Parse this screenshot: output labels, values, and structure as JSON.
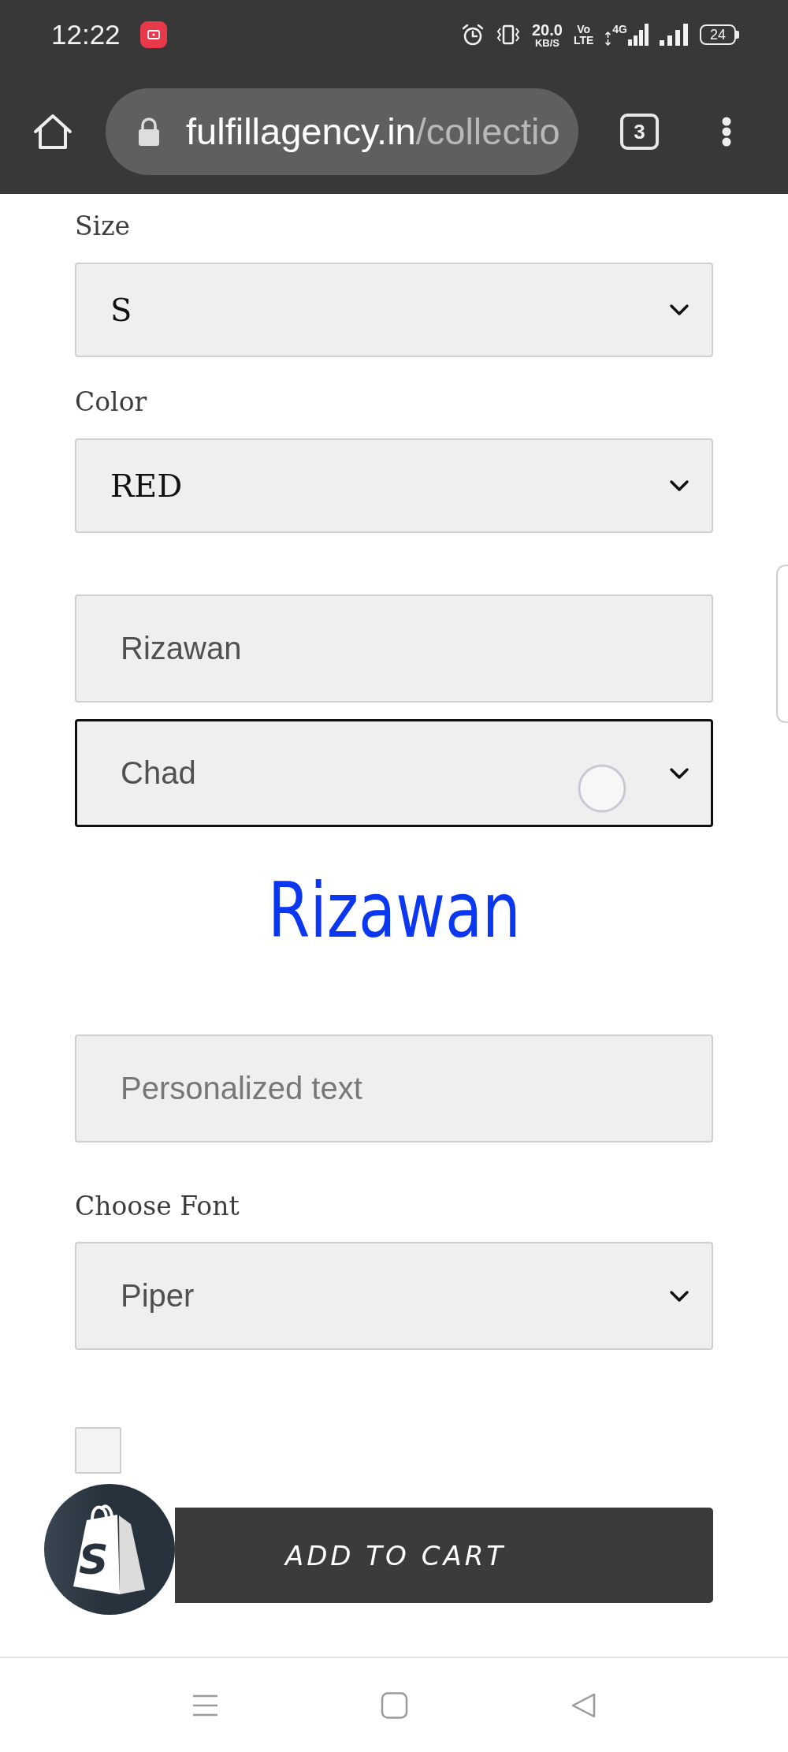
{
  "status_bar": {
    "time": "12:22",
    "speed": "20.0",
    "speed_unit": "KB/S",
    "volte": [
      "Vo",
      "LTE"
    ],
    "network_type": "4G",
    "battery": "24"
  },
  "browser_bar": {
    "url_host": "fulfillagency.in",
    "url_path": "/collectio",
    "tab_count": "3"
  },
  "variant_options": [
    {
      "label": "Size",
      "value": "S"
    },
    {
      "label": "Color",
      "value": "RED"
    }
  ],
  "personalization": {
    "fields": [
      {
        "kind": "input",
        "value": "Rizawan",
        "focused": false,
        "touched": false
      },
      {
        "kind": "select",
        "value": "Chad",
        "focused": true,
        "touched": true
      }
    ],
    "preview_text": "Rizawan",
    "text_field": {
      "placeholder": "Personalized text"
    },
    "font_select": {
      "label": "Choose Font",
      "value": "Piper"
    }
  },
  "checkbox": {
    "checked": false
  },
  "add_to_cart": {
    "label": "ADD TO CART"
  },
  "store_badge": {
    "letter": "S"
  }
}
